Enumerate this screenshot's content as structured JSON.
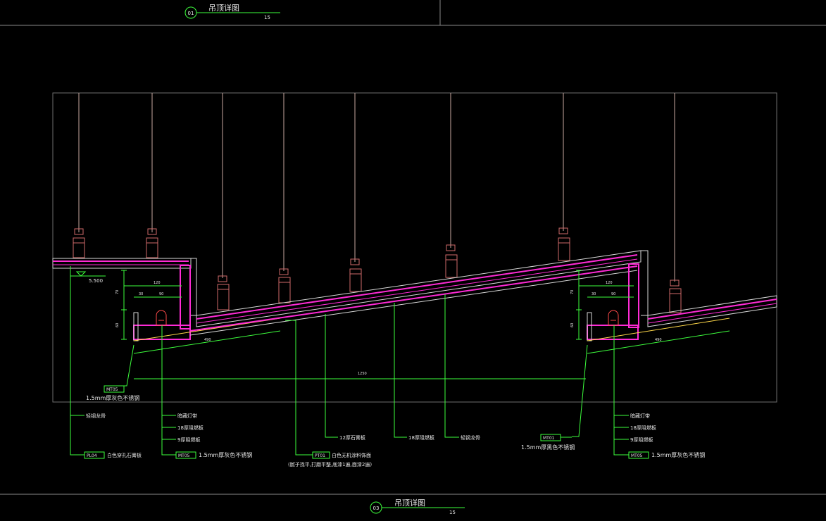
{
  "title_top": {
    "number": "01",
    "label": "吊顶详图",
    "scale": "15"
  },
  "title_bottom": {
    "number": "03",
    "label": "吊顶详图",
    "scale": "15"
  },
  "elevation": "5.500",
  "dimensions": {
    "a120": "120",
    "a30": "30",
    "a90": "90",
    "v70": "70",
    "v60": "60",
    "span490": "490",
    "span1250": "1250",
    "r120": "120",
    "r30": "30",
    "r90": "90",
    "rv70": "70",
    "rv60": "60",
    "rspan490": "490"
  },
  "callouts": {
    "mt05_left_code": "MT05",
    "mt05_left_text": "1.5mm厚灰色不锈钢",
    "keel": "轻钢龙骨",
    "pl04_code": "PL04",
    "pl04_text": "白色穿孔石膏板",
    "led_strip": "暗藏灯带",
    "board18": "18厚阻燃板",
    "board9": "9厚阻燃板",
    "mt05_mid_code": "MT05",
    "mt05_mid_text": "1.5mm厚灰色不锈钢",
    "pt01_code": "PT01",
    "pt01_text": "白色无机涂料饰面",
    "pt01_note": "(腻子找平,打磨平整,底漆1遍,面漆2遍)",
    "gypsum12": "12厚石膏板",
    "board18_b": "18厚阻燃板",
    "keel_b": "轻钢龙骨",
    "mt01_code": "MT01",
    "mt01_text": "1.5mm厚黑色不锈钢",
    "r_led_strip": "暗藏灯带",
    "r_board18": "18厚阻燃板",
    "r_board9": "9厚阻燃板",
    "mt05_right_code": "MT05",
    "mt05_right_text": "1.5mm厚灰色不锈钢"
  },
  "colors": {
    "background": "#000000",
    "frame": "#9a9a9a",
    "hanger": "#c8a8a0",
    "hanger_body": "#d06a6a",
    "ceiling_layer": "#ff2bd6",
    "ceiling_edge": "#d9d9d9",
    "leader": "#3dff3d",
    "light": "#ff4a4a",
    "finish": "#ffd84a",
    "text": "#e6e6e6"
  }
}
